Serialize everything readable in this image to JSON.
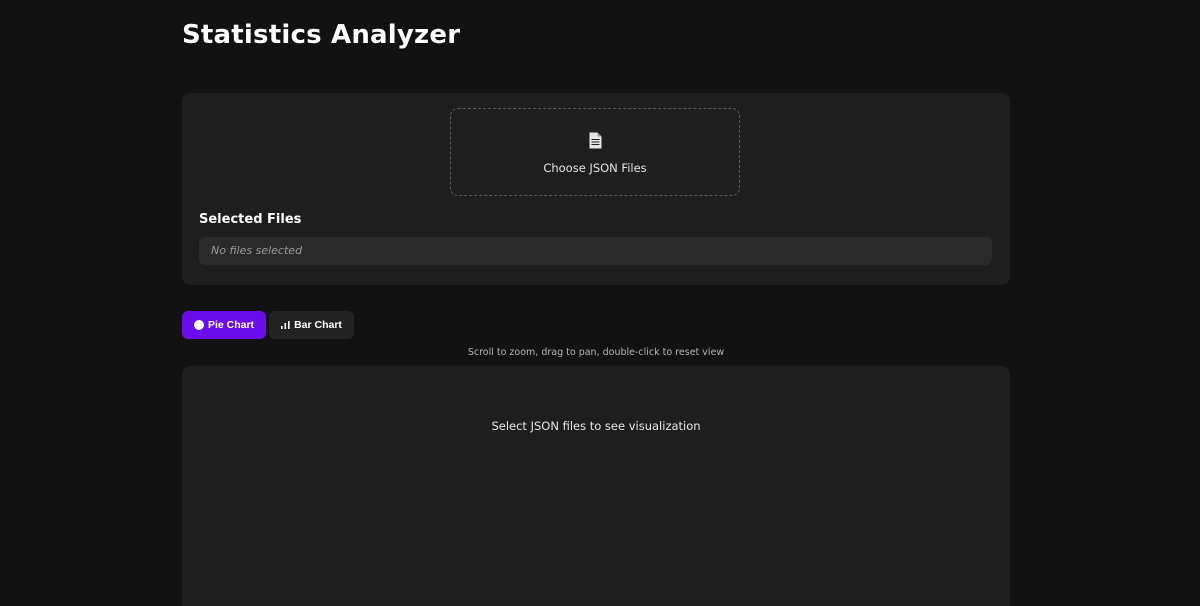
{
  "page": {
    "title": "Statistics Analyzer"
  },
  "upload": {
    "drop_icon": "file-icon",
    "drop_label": "Choose JSON Files",
    "selected_heading": "Selected Files",
    "empty_text": "No files selected"
  },
  "chart_toggle": {
    "pie_label": "Pie Chart",
    "pie_icon": "pie-circle-icon",
    "bar_label": "Bar Chart",
    "bar_icon": "bar-chart-icon",
    "active": "pie",
    "active_color": "#6a0dea"
  },
  "visualization": {
    "hint": "Scroll to zoom, drag to pan, double-click to reset view",
    "placeholder": "Select JSON files to see visualization"
  },
  "colors": {
    "background": "#121212",
    "card": "#1e1e1e",
    "accent": "#6a0dea"
  }
}
